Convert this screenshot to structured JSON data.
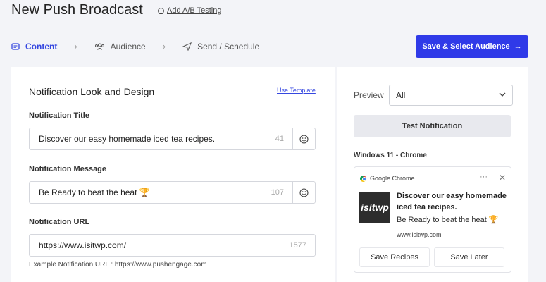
{
  "header": {
    "title": "New Push Broadcast",
    "ab_testing": "Add A/B Testing"
  },
  "steps": [
    {
      "label": "Content",
      "icon": "content-icon",
      "active": true
    },
    {
      "label": "Audience",
      "icon": "users-icon",
      "active": false
    },
    {
      "label": "Send / Schedule",
      "icon": "send-icon",
      "active": false
    }
  ],
  "save_button": "Save & Select Audience",
  "form": {
    "section_title": "Notification Look and Design",
    "use_template": "Use Template",
    "title_label": "Notification Title",
    "title_value": "Discover our easy homemade iced tea recipes.",
    "title_count": "41",
    "message_label": "Notification Message",
    "message_value": "Be Ready to beat the heat 🏆",
    "message_count": "107",
    "url_label": "Notification URL",
    "url_value": "https://www.isitwp.com/",
    "url_count": "1577",
    "url_example": "Example Notification URL : https://www.pushengage.com"
  },
  "preview": {
    "label": "Preview",
    "selected": "All",
    "test_button": "Test Notification",
    "platform": "Windows 11 - Chrome",
    "notification": {
      "browser": "Google Chrome",
      "logo_text": "isitwp",
      "title": "Discover our easy homemade iced tea recipes.",
      "message": "Be Ready to beat the heat 🏆",
      "url": "www.isitwp.com",
      "button1": "Save Recipes",
      "button2": "Save Later"
    }
  },
  "colors": {
    "accent": "#2f3ae8",
    "background": "#f3f4f8"
  }
}
